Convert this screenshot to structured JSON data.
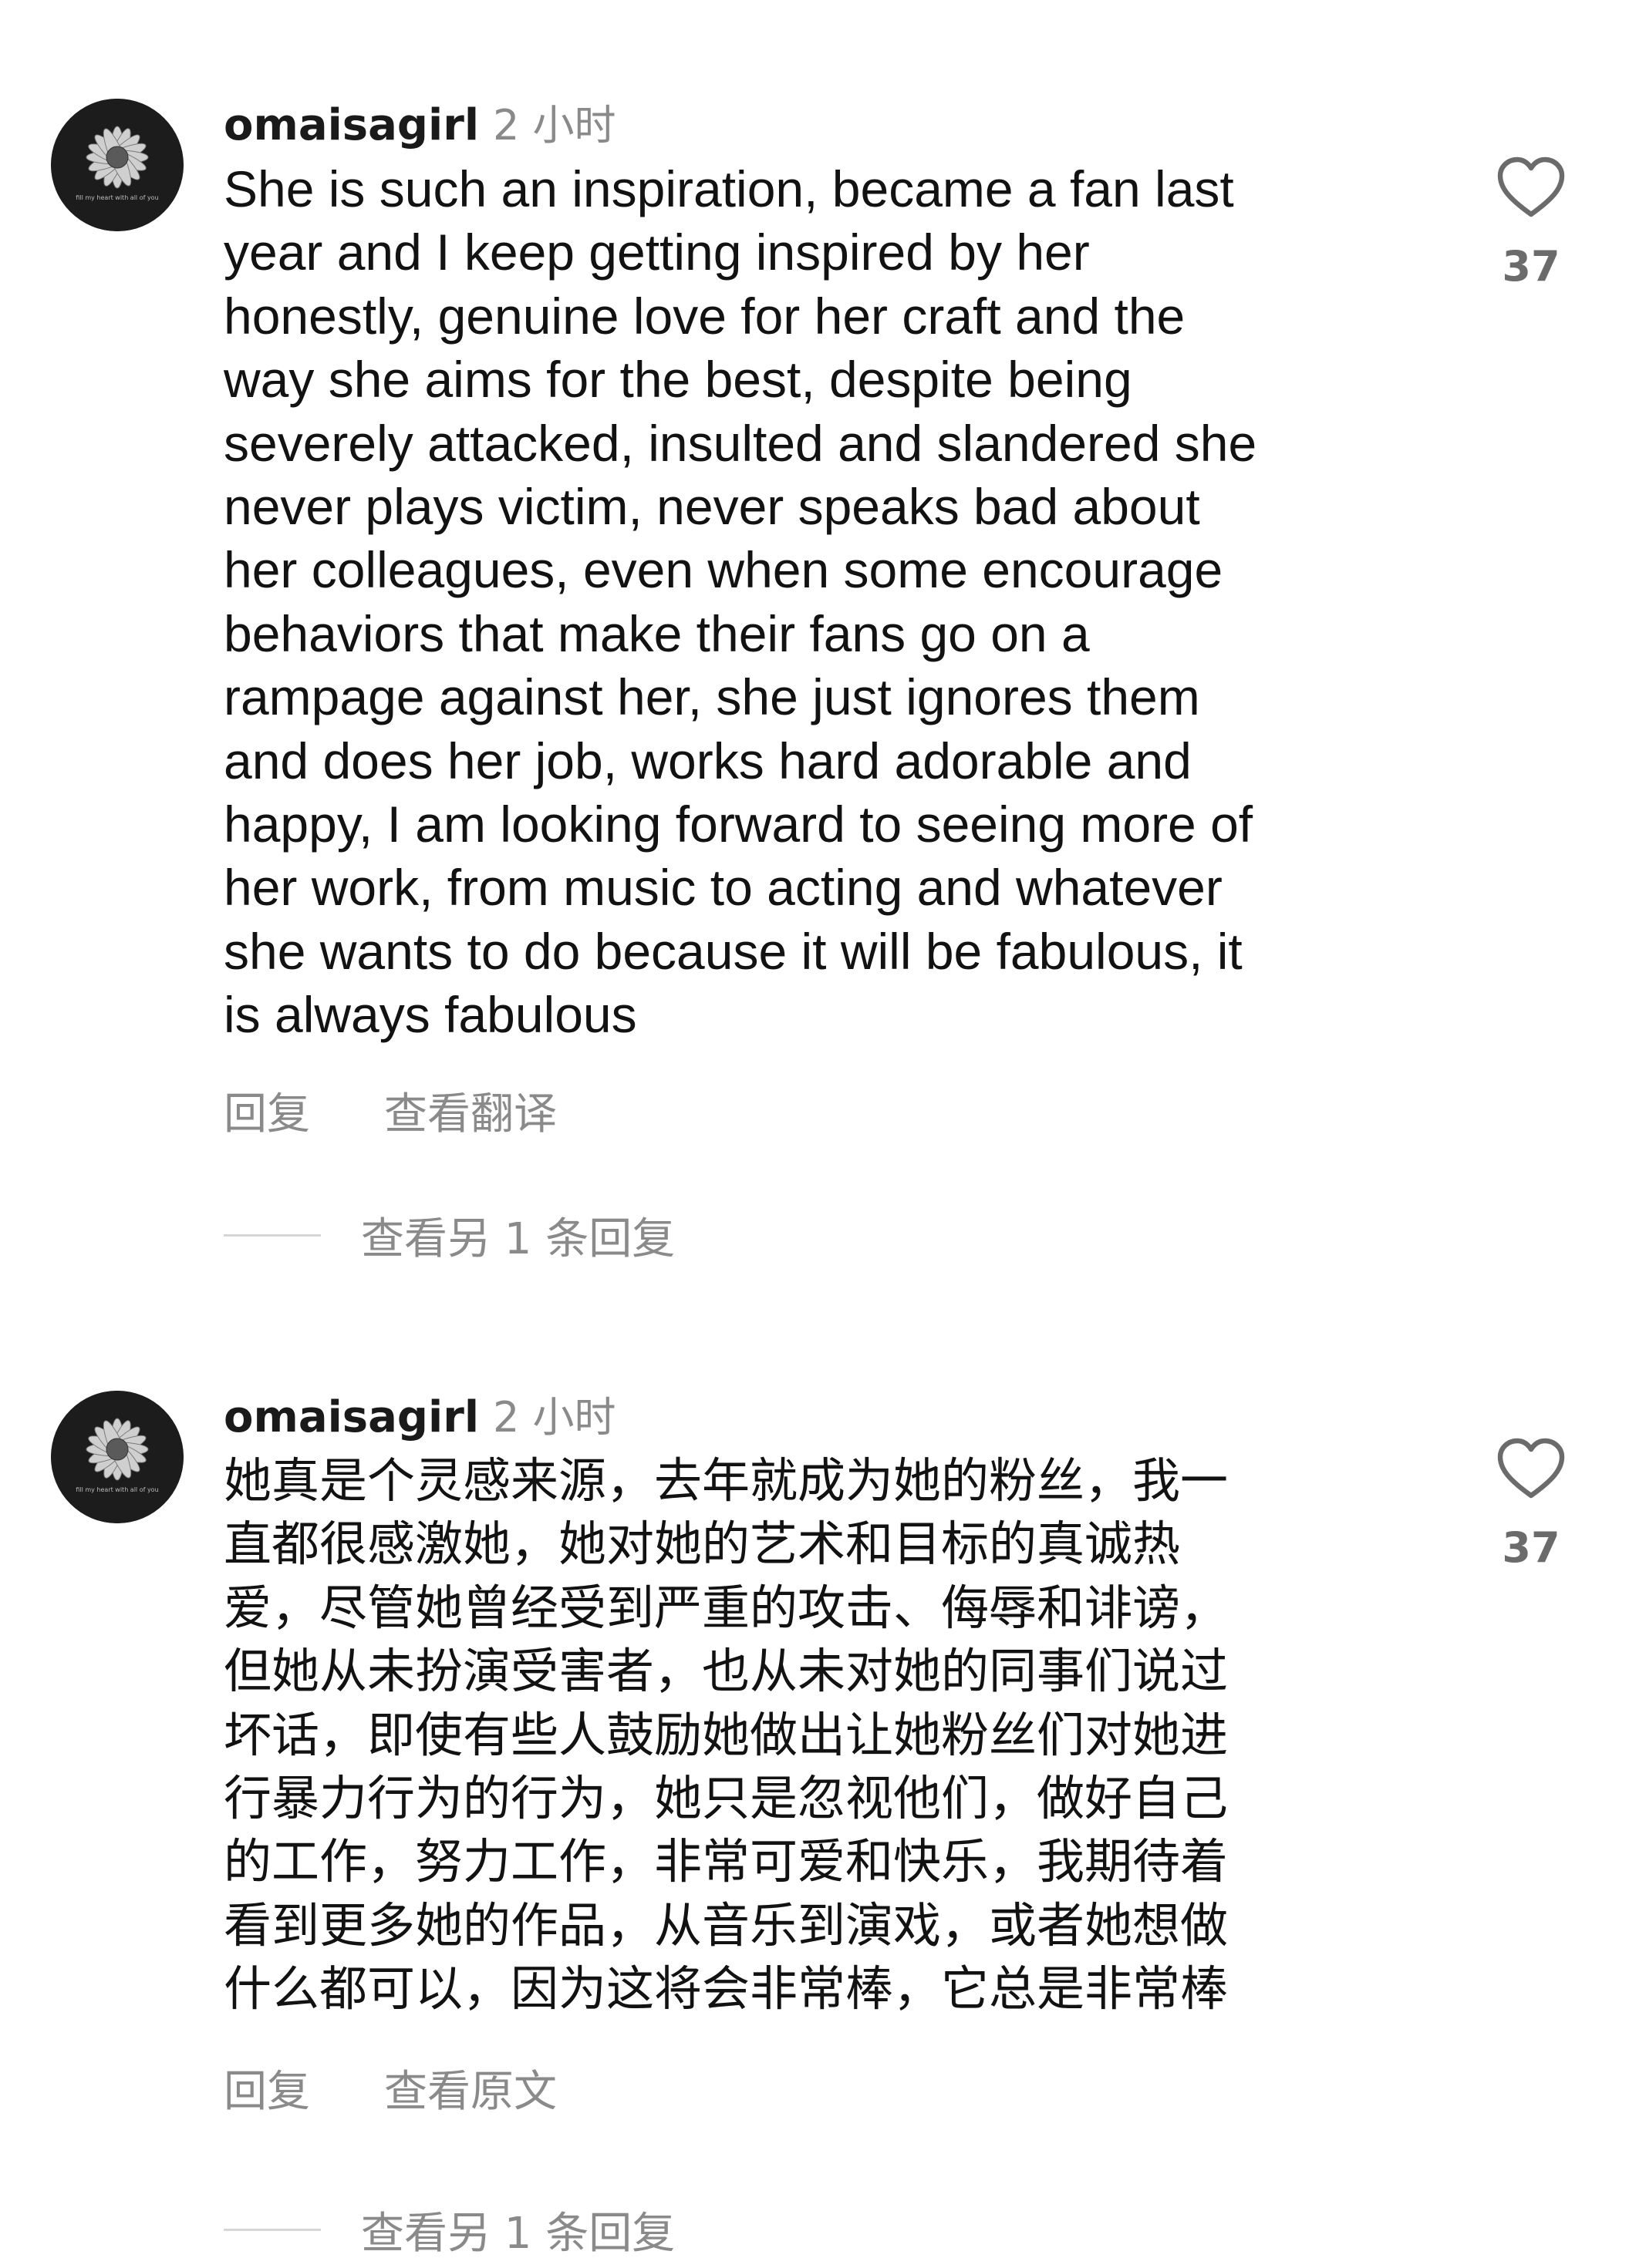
{
  "comments": [
    {
      "username": "omaisagirl",
      "timestamp": "2 小时",
      "avatar_caption": "fill my heart with all of you",
      "text_lines": [
        "She is such an inspiration, became a fan last",
        "year and I keep getting inspired by her",
        "honestly, genuine love for her craft and the",
        "way she aims for the best, despite being",
        "severely attacked, insulted and slandered she",
        "never plays victim, never speaks bad about",
        "her colleagues, even when some encourage",
        "behaviors that make their fans go on a",
        "rampage against her, she just ignores them",
        "and does her job, works hard adorable and",
        "happy, I am looking forward to seeing more of",
        "her work, from music to acting and whatever",
        "she wants to do because it will be fabulous, it",
        "is always fabulous"
      ],
      "reply_label": "回复",
      "translate_label": "查看翻译",
      "view_replies_label": "查看另 1 条回复",
      "like_count": "37",
      "like_icon": "heart-outline-icon"
    },
    {
      "username": "omaisagirl",
      "timestamp": "2 小时",
      "avatar_caption": "fill my heart with all of you",
      "text_lines": [
        "她真是个灵感来源，去年就成为她的粉丝，我一",
        "直都很感激她，她对她的艺术和目标的真诚热",
        "爱，尽管她曾经受到严重的攻击、侮辱和诽谤，",
        "但她从未扮演受害者，也从未对她的同事们说过",
        "坏话，即使有些人鼓励她做出让她粉丝们对她进",
        "行暴力行为的行为，她只是忽视他们，做好自己",
        "的工作，努力工作，非常可爱和快乐，我期待着",
        "看到更多她的作品，从音乐到演戏，或者她想做",
        "什么都可以，因为这将会非常棒，它总是非常棒"
      ],
      "reply_label": "回复",
      "translate_label": "查看原文",
      "view_replies_label": "查看另 1 条回复",
      "like_count": "37",
      "like_icon": "heart-outline-icon"
    }
  ],
  "colors": {
    "text": "#121212",
    "muted": "#8a8a8a",
    "avatar_bg": "#1c1c1c"
  }
}
